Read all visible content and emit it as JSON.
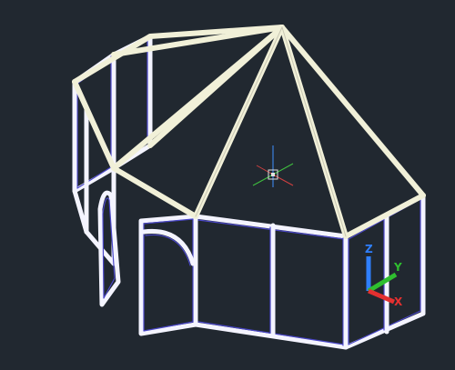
{
  "viewport": {
    "background": "#212830",
    "wire_color": "#f4f4ff",
    "roof_color": "#f1f0d8",
    "edge_color": "#4a47c8"
  },
  "ucs_icon": {
    "x_label": "X",
    "y_label": "Y",
    "z_label": "Z",
    "x_color": "#e33030",
    "y_color": "#2fbf2f",
    "z_color": "#2f7fff"
  },
  "pivot_gizmo": {
    "icon": "orbit-center-icon",
    "colors": [
      "#3f8fff",
      "#3fbf3f",
      "#d04040",
      "#c0c0c0"
    ]
  }
}
